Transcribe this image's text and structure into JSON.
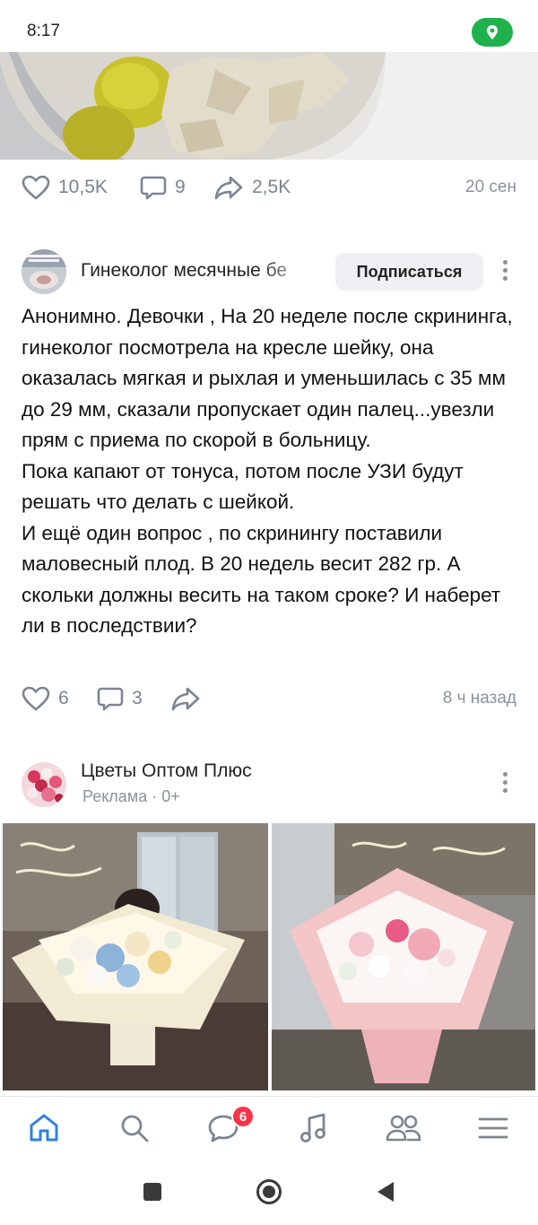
{
  "status_bar": {
    "time": "8:17"
  },
  "previous_post": {
    "likes": "10,5K",
    "comments": "9",
    "shares": "2,5K",
    "time": "20 сен"
  },
  "post": {
    "group_name": "Гинеколог месячные бе",
    "subscribe_label": "Подписаться",
    "paragraphs": [
      "Анонимно. Девочки , На 20 неделе после скрининга, гинеколог посмотрела на кресле шейку, она оказалась мягкая и рыхлая и уменьшилась с 35 мм до 29 мм, сказали пропускает один палец...увезли прям с приема по скорой в больницу.",
      "Пока капают от тонуса, потом после УЗИ будут решать что делать с шейкой.",
      "И ещё один вопрос , по скринингу поставили маловесный плод. В 20 недель весит 282 гр. А скольки должны весить на таком сроке? И наберет ли в последствии?"
    ],
    "likes": "6",
    "comments": "3",
    "time": "8 ч назад"
  },
  "ad_post": {
    "group_name": "Цветы Оптом Плюс",
    "subtitle": "Реклама · 0+"
  },
  "tab_bar": {
    "items": [
      "home-icon",
      "search-icon",
      "messages-icon",
      "music-icon",
      "friends-icon",
      "menu-icon"
    ],
    "messages_badge": "6",
    "accent": "#2d81e0"
  },
  "colors": {
    "meta_gray": "#8b929b",
    "badge_red": "#ff3347",
    "location_green": "#1fb24c"
  }
}
